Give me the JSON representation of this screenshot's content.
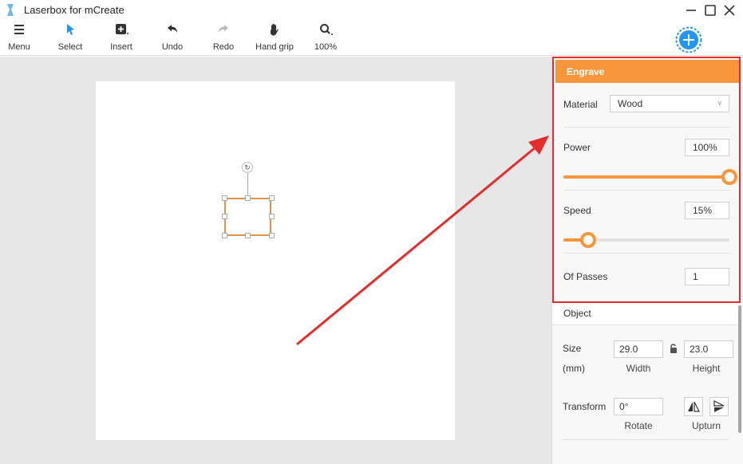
{
  "window": {
    "title": "Laserbox for mCreate"
  },
  "toolbar": {
    "menu": "Menu",
    "select": "Select",
    "insert": "Insert",
    "undo": "Undo",
    "redo": "Redo",
    "hand_grip": "Hand grip",
    "zoom": "100%"
  },
  "engrave": {
    "header": "Engrave",
    "material_label": "Material",
    "material_value": "Wood",
    "power_label": "Power",
    "power_value": "100%",
    "power_level": 1.0,
    "speed_label": "Speed",
    "speed_value": "15%",
    "speed_level": 0.15,
    "passes_label": "Of Passes",
    "passes_value": "1"
  },
  "object": {
    "header": "Object",
    "size_label": "Size",
    "unit_label": "(mm)",
    "width_value": "29.0",
    "height_value": "23.0",
    "width_label": "Width",
    "height_label": "Height",
    "transform_label": "Transform",
    "rotate_value": "0°",
    "rotate_label": "Rotate",
    "upturn_label": "Upturn"
  },
  "colors": {
    "accent": "#f7963a",
    "annotation": "#e52d2d",
    "fab": "#2196f3"
  }
}
